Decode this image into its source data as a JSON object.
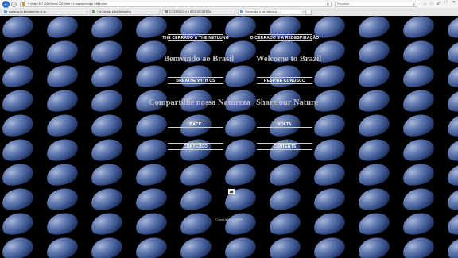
{
  "browser": {
    "address": "F:\\Oblip 1997 2008\\Steven 2001\\Web 9.1 maybado image 1\\Bilaz.html",
    "search_placeholder": "Pesquisar...",
    "tabs": [
      {
        "label": "avaliacao no licenciamento do im...",
        "active": false
      },
      {
        "label": "The Cerrado & the Netfuturing",
        "active": false
      },
      {
        "label": "O CERRADO E A REDESCOBERTA",
        "active": false
      },
      {
        "label": "The cerrado & the Netfurling",
        "active": true
      }
    ]
  },
  "page": {
    "link_cerrado_en": "THE CERRADO & THE NETLUNG",
    "link_cerrado_pt": "O CERRADO E A REDESPIRAÇÃO",
    "welcome_pt": "Bemvindo ao Brasil",
    "welcome_en": "Welcome to Brazil",
    "link_breathe_en": "BREATHE WITH US",
    "link_breathe_pt": "RESPIRE CONOSCO",
    "share_pt": "Compartilhe nossa Natureza",
    "share_en": "Share our Nature",
    "link_back": "BACK",
    "link_volta": "VOLTA",
    "link_conteudo": "CONTEUDO",
    "link_contents": "CONTENTS",
    "copyright": "Copyright © 1998"
  },
  "icons": {
    "back": "arrow-left-icon",
    "forward": "arrow-right-icon",
    "search": "search-icon",
    "home": "home-icon"
  }
}
